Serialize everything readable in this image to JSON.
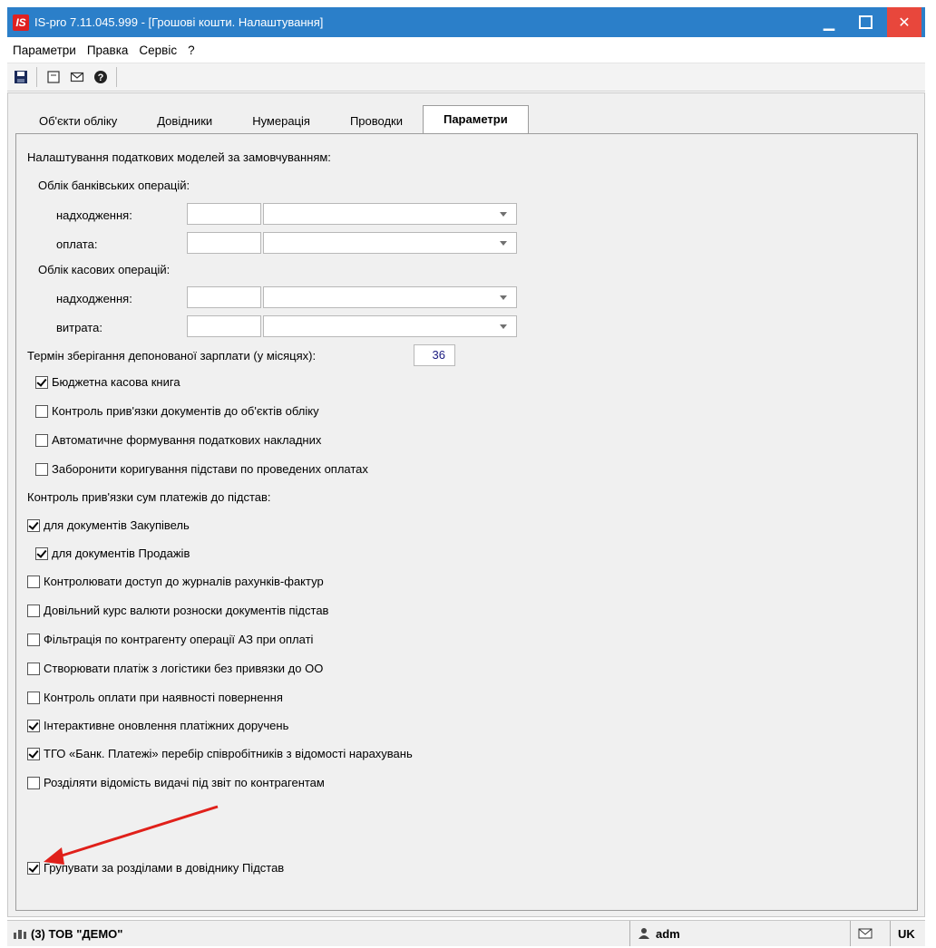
{
  "window": {
    "title": "IS-pro 7.11.045.999 - [Грошові кошти. Налаштування]",
    "logo_text": "IS"
  },
  "menu": [
    "Параметри",
    "Правка",
    "Сервіс",
    "?"
  ],
  "toolbar": {
    "icons": [
      "save-icon",
      "document-icon",
      "mail-icon",
      "help-icon"
    ]
  },
  "tabs": [
    {
      "label": "Об'єкти обліку",
      "active": false
    },
    {
      "label": "Довідники",
      "active": false
    },
    {
      "label": "Нумерація",
      "active": false
    },
    {
      "label": "Проводки",
      "active": false
    },
    {
      "label": "Параметри",
      "active": true
    }
  ],
  "form": {
    "tax_models_heading": "Налаштування податкових моделей за замовчуванням:",
    "bank_heading": "Облік банківських операцій:",
    "bank_income_label": "надходження:",
    "bank_payment_label": "оплата:",
    "cash_heading": "Облік касових операцій:",
    "cash_income_label": "надходження:",
    "cash_expense_label": "витрата:",
    "deposit_label": "Термін зберігання депонованої зарплати (у місяцях):",
    "deposit_value": "36",
    "checkboxes_1": [
      {
        "label": "Бюджетна касова книга",
        "checked": true
      },
      {
        "label": "Контроль прив'язки документів до об'єктів обліку",
        "checked": false
      },
      {
        "label": "Автоматичне формування податкових накладних",
        "checked": false
      },
      {
        "label": "Заборонити  коригування підстави по проведених оплатах",
        "checked": false
      }
    ],
    "payments_heading": "Контроль прив'язки сум платежів до підстав:",
    "checkboxes_2": [
      {
        "label": "для документів Закупівель",
        "checked": true
      },
      {
        "label": "для документів Продажів",
        "checked": true
      },
      {
        "label": "Контролювати доступ до журналів рахунків-фактур",
        "checked": false
      },
      {
        "label": "Довільний курс валюти розноски  документів підстав",
        "checked": false
      },
      {
        "label": "Фільтрація по контрагенту операції АЗ при оплаті",
        "checked": false
      },
      {
        "label": "Створювати платіж з логістики без привязки до ОО",
        "checked": false
      },
      {
        "label": "Контроль оплати при наявності повернення",
        "checked": false
      },
      {
        "label": "Інтерактивне оновлення платіжних доручень",
        "checked": true
      },
      {
        "label": "ТГО «Банк. Платежі» перебір співробітників з відомості нарахувань",
        "checked": true
      },
      {
        "label": "Розділяти відомість видачі під звіт по контрагентам",
        "checked": false
      },
      {
        "label": "Групувати за розділами в довіднику Підстав",
        "checked": true
      }
    ]
  },
  "status": {
    "company": "(3) ТОВ \"ДЕМО\"",
    "user": "adm",
    "lang": "UK"
  },
  "colors": {
    "titlebar": "#2b7fc9",
    "close": "#e8473c",
    "annotation_arrow": "#e0201a"
  }
}
